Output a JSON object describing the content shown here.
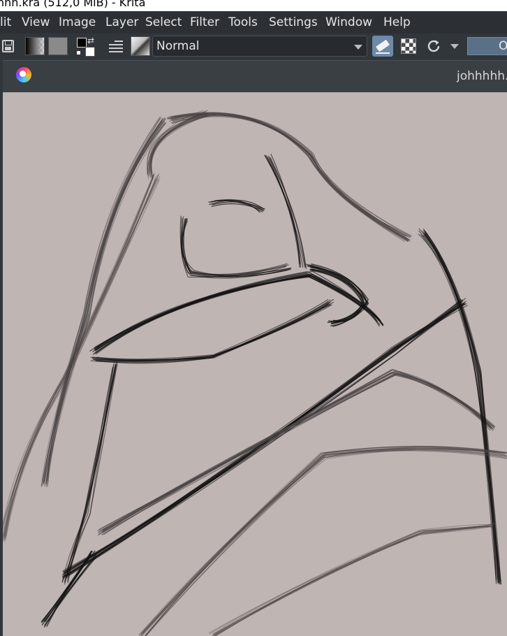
{
  "window": {
    "title": "hhh.kra (512,0 MiB)  - Krita"
  },
  "menubar": {
    "items": [
      {
        "label": "lit"
      },
      {
        "label": "View"
      },
      {
        "label": "Image"
      },
      {
        "label": "Layer"
      },
      {
        "label": "Select"
      },
      {
        "label": "Filter"
      },
      {
        "label": "Tools"
      },
      {
        "label": "Settings"
      },
      {
        "label": "Window"
      },
      {
        "label": "Help"
      }
    ]
  },
  "toolbar": {
    "blend_mode": "Normal",
    "opacity_value": "O",
    "icons": [
      "save-icon",
      "gradient-icon",
      "pattern-icon",
      "fg-bg-color-icon",
      "brush-settings-icon",
      "brush-preset-icon",
      "eraser-icon",
      "alpha-lock-icon",
      "reload-icon"
    ]
  },
  "document": {
    "tab_title": "johhhhh.",
    "canvas_color": "#bfb5b3"
  }
}
